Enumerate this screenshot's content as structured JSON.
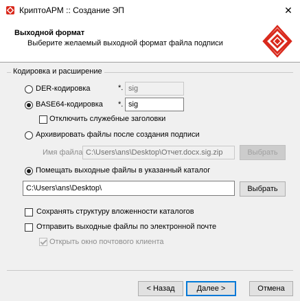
{
  "window": {
    "title": "КриптоАРМ :: Создание ЭП",
    "close_glyph": "✕"
  },
  "header": {
    "title": "Выходной формат",
    "subtitle": "Выберите желаемый выходной формат файла подписи"
  },
  "group": {
    "label": "Кодировка и расширение"
  },
  "options": {
    "der": {
      "label": "DER-кодировка",
      "checked": false,
      "ext_prefix": "*.",
      "ext_value": "sig",
      "ext_enabled": false
    },
    "base64": {
      "label": "BASE64-кодировка",
      "checked": true,
      "ext_prefix": "*.",
      "ext_value": "sig",
      "ext_enabled": true
    },
    "disable_headers": {
      "label": "Отключить служебные заголовки",
      "checked": false
    },
    "archive": {
      "label": "Архивировать файлы после создания подписи",
      "checked": false,
      "filename_label": "Имя файла:",
      "filename_value": "C:\\Users\\ans\\Desktop\\Отчет.docx.sig.zip",
      "browse_label": "Выбрать"
    },
    "directory": {
      "label": "Помещать выходные файлы в указанный каталог",
      "checked": true,
      "path_value": "C:\\Users\\ans\\Desktop\\",
      "browse_label": "Выбрать"
    },
    "keep_structure": {
      "label": "Сохранять структуру вложенности каталогов",
      "checked": false
    },
    "send_email": {
      "label": "Отправить выходные файлы по электронной почте",
      "checked": false
    },
    "open_mail_client": {
      "label": "Открыть окно почтового клиента",
      "checked": true,
      "enabled": false
    }
  },
  "footer": {
    "back_label": "< Назад",
    "next_label": "Далее >",
    "cancel_label": "Отмена"
  },
  "colors": {
    "logo_red": "#d9291c",
    "default_button_border": "#0078d7"
  },
  "icons": {
    "app": "app-shield-icon",
    "logo": "cryptoarm-logo"
  }
}
